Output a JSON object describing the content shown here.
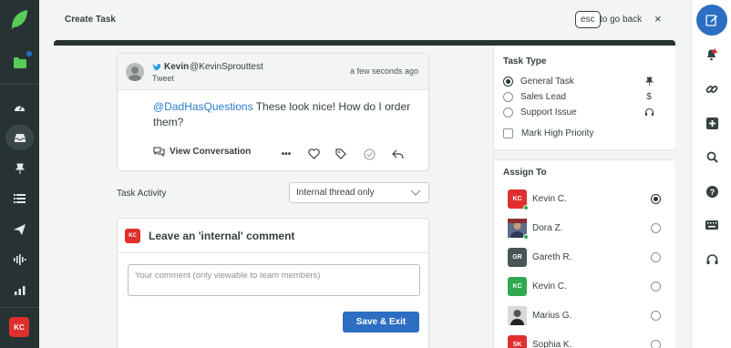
{
  "header": {
    "title": "Create Task",
    "esc_key": "esc",
    "esc_hint": "to go back",
    "close": "×"
  },
  "left_rail": {
    "items": [
      "messages-icon",
      "dashboard-icon",
      "inbox-icon",
      "tasks-pin-icon",
      "list-icon",
      "publishing-icon",
      "listening-icon",
      "reports-icon"
    ],
    "user_initials": "KC",
    "user_color": "#e02f2f"
  },
  "tweet": {
    "author_name": "Kevin",
    "author_handle": "@KevinSprouttest",
    "type": "Tweet",
    "time": "a few seconds ago",
    "mention": "@DadHasQuestions",
    "body": " These look nice! How do I order them?",
    "view_conversation": "View Conversation",
    "more": "•••"
  },
  "task_activity": {
    "label": "Task Activity",
    "selected": "Internal thread only"
  },
  "comment": {
    "avatar_initials": "KC",
    "title": "Leave an 'internal' comment",
    "placeholder": "Your comment (only viewable to team members)",
    "save_label": "Save & Exit"
  },
  "task_type": {
    "title": "Task Type",
    "options": [
      {
        "label": "General Task",
        "selected": true,
        "icon": "pin-icon"
      },
      {
        "label": "Sales Lead",
        "selected": false,
        "icon": "dollar-icon"
      },
      {
        "label": "Support Issue",
        "selected": false,
        "icon": "headset-icon"
      }
    ],
    "high_priority_label": "Mark High Priority",
    "high_priority_checked": false
  },
  "assign_to": {
    "title": "Assign To",
    "people": [
      {
        "name": "Kevin C.",
        "initials": "KC",
        "color": "#e02f2f",
        "selected": true,
        "online": true
      },
      {
        "name": "Dora Z.",
        "initials": "",
        "color": "#5a6d8a",
        "selected": false,
        "online": true
      },
      {
        "name": "Gareth R.",
        "initials": "GR",
        "color": "#4b5555",
        "selected": false,
        "online": false
      },
      {
        "name": "Kevin C.",
        "initials": "KC",
        "color": "#2fa84f",
        "selected": false,
        "online": false
      },
      {
        "name": "Marius G.",
        "initials": "",
        "color": "#2d2d2d",
        "selected": false,
        "online": false
      },
      {
        "name": "Sophia K.",
        "initials": "SK",
        "color": "#e02f2f",
        "selected": false,
        "online": false
      }
    ]
  },
  "right_rail": {
    "items": [
      "compose-icon",
      "notifications-icon",
      "link-icon",
      "add-icon",
      "search-icon",
      "help-icon",
      "keyboard-icon",
      "feedback-icon"
    ],
    "accent": "#2b6ec2"
  }
}
